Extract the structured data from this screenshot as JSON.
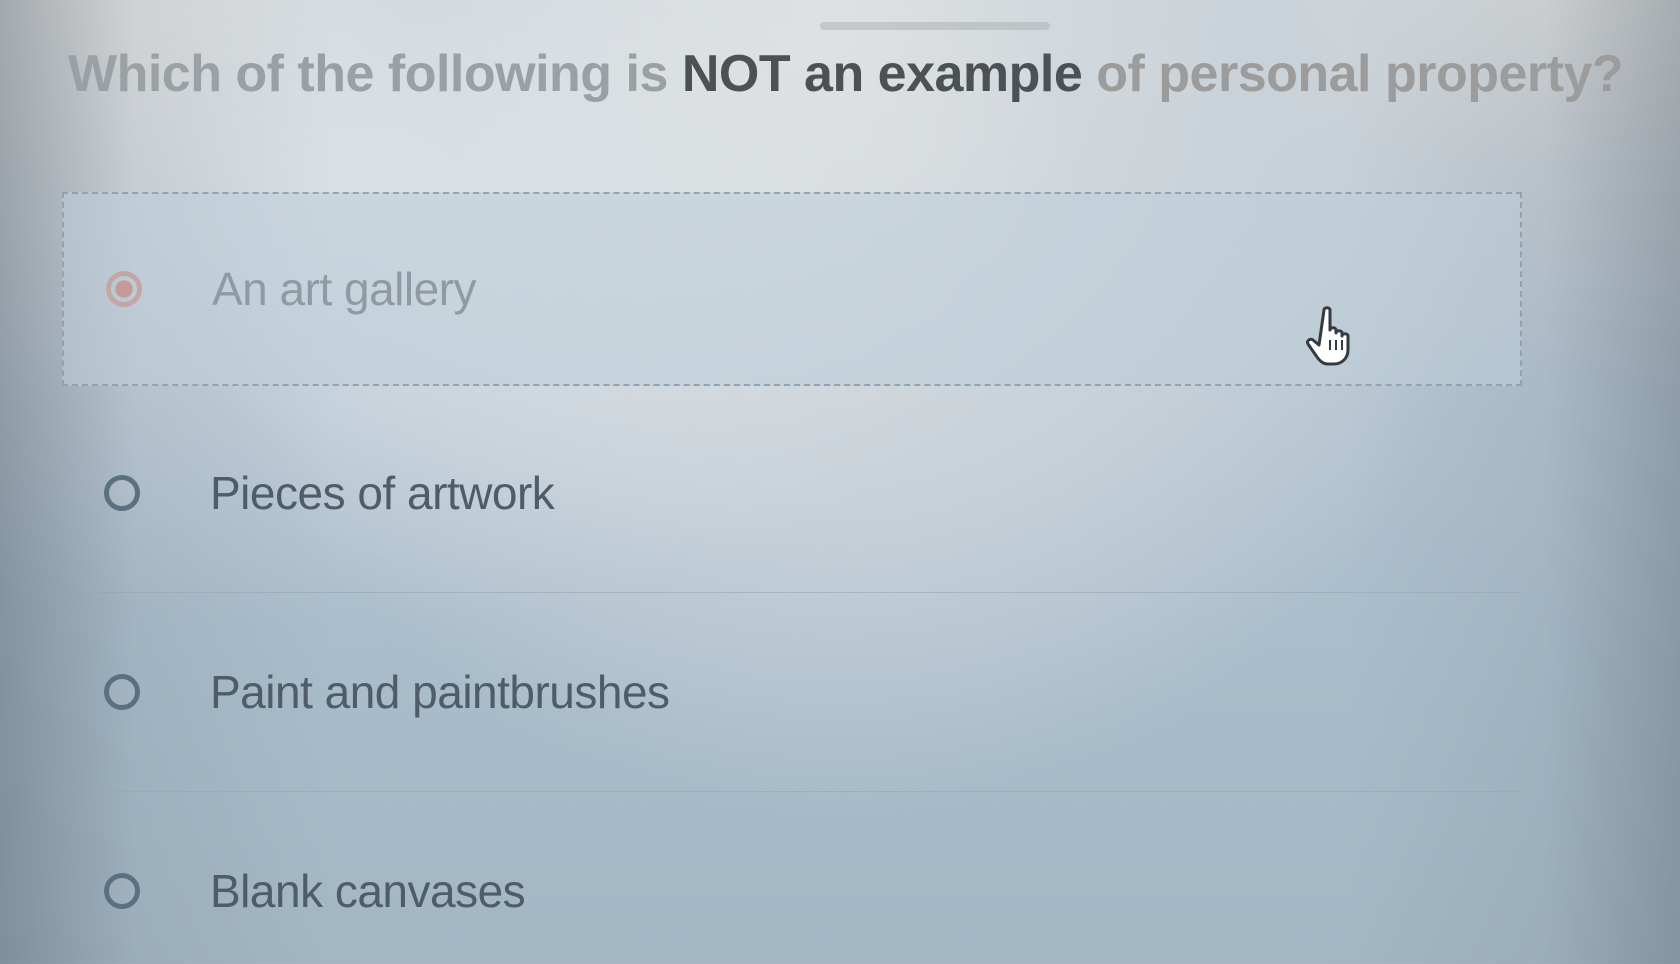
{
  "question": {
    "part1": "Which of the following is ",
    "emphasis": "NOT an example",
    "part2": " of personal property?"
  },
  "options": [
    {
      "label": "An art gallery",
      "selected": true
    },
    {
      "label": "Pieces of artwork",
      "selected": false
    },
    {
      "label": "Paint and paintbrushes",
      "selected": false
    },
    {
      "label": "Blank canvases",
      "selected": false
    }
  ],
  "colors": {
    "background": "#a8bccb",
    "option_text": "#4e5d68",
    "radio_border": "#5b7182",
    "selected_radio": "#c69a9a"
  },
  "icons": {
    "cursor": "hand-pointer-icon"
  }
}
